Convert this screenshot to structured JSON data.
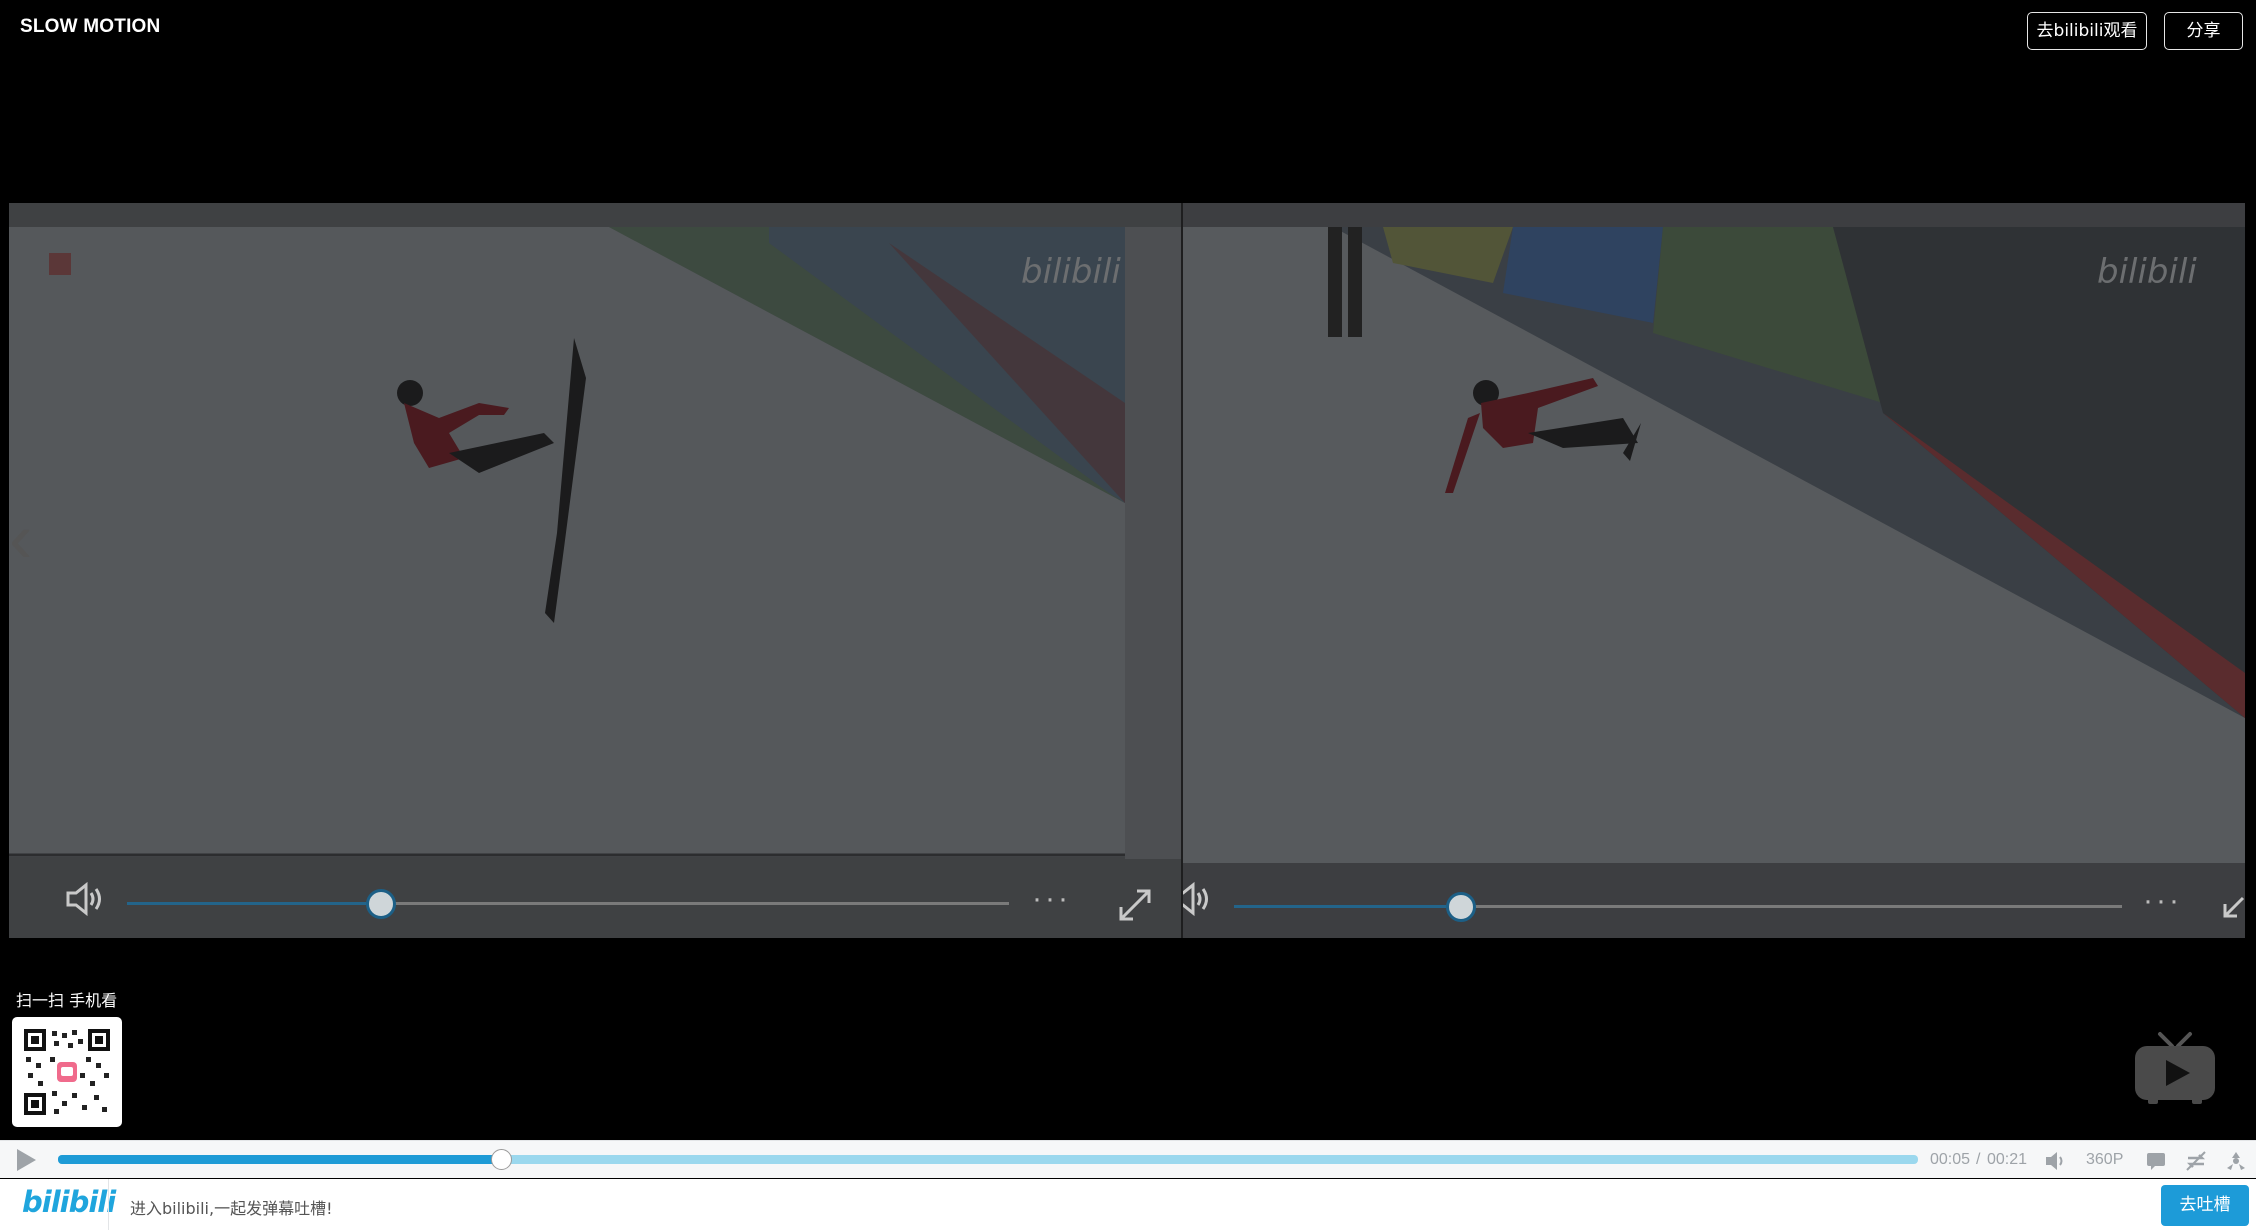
{
  "header": {
    "title": "SLOW MOTION",
    "open_bilibili_label": "去bilibili观看",
    "share_label": "分享"
  },
  "video": {
    "left_pane": {
      "watermark": "bilibili",
      "progress_fraction": 0.29
    },
    "right_pane": {
      "watermark": "bilibili",
      "progress_fraction": 0.25
    }
  },
  "qr": {
    "title": "扫一扫 手机看"
  },
  "player_bar": {
    "current_time": "00:05",
    "separator": "/",
    "duration": "00:21",
    "quality": "360P",
    "progress_fraction": 0.238
  },
  "danmaku_bar": {
    "logo": "bilibili",
    "placeholder": "进入bilibili,一起发弹幕吐槽!",
    "send_label": "去吐槽"
  },
  "colors": {
    "accent": "#1d9bd8",
    "progress_fill": "#1e9bd6",
    "progress_track": "#9bd8ee"
  }
}
